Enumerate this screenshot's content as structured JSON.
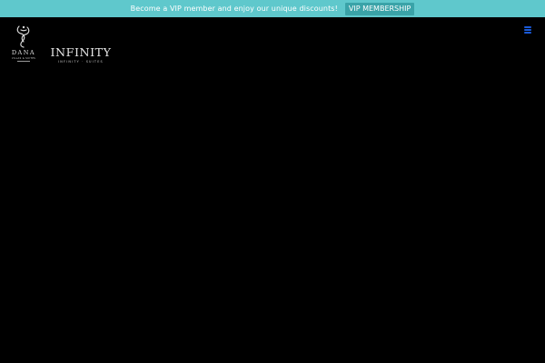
{
  "promo": {
    "message": "Become a VIP member and enjoy our unique discounts!",
    "button_label": "VIP MEMBERSHIP"
  },
  "brands": {
    "dana_logo": "DANA VILLAS & SUITES",
    "infinity_logo": "INFINITY INFINITY SUITES"
  },
  "icons": {
    "menu": "hamburger-menu-icon"
  },
  "colors": {
    "promo_background": "#5fc8cc",
    "promo_button_background": "#3aa3a8",
    "page_background": "#000000",
    "menu_icon": "#1a5ad8"
  }
}
